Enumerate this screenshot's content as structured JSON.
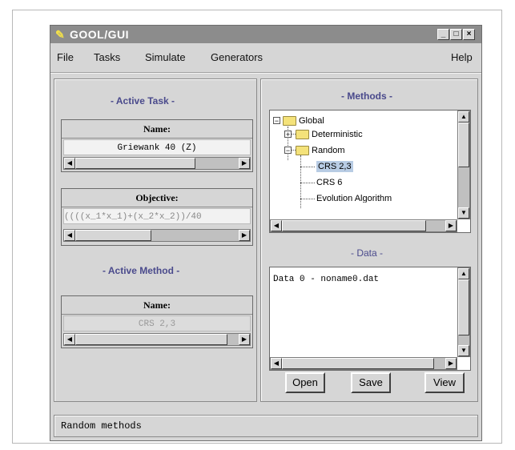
{
  "window": {
    "title": "GOOL/GUI"
  },
  "menu": {
    "file": "File",
    "tasks": "Tasks",
    "simulate": "Simulate",
    "generators": "Generators",
    "help": "Help"
  },
  "active_task": {
    "section_title": "- Active Task -",
    "name_header": "Name:",
    "name_value": "Griewank 40 (Z)",
    "objective_header": "Objective:",
    "objective_value": "((((x_1*x_1)+(x_2*x_2))/40"
  },
  "active_method": {
    "section_title": "- Active Method -",
    "name_header": "Name:",
    "name_value": "CRS 2,3"
  },
  "methods": {
    "section_title": "- Methods -",
    "tree": {
      "root": "Global",
      "deterministic": "Deterministic",
      "random": "Random",
      "items": [
        "CRS 2,3",
        "CRS 6",
        "Evolution Algorithm"
      ]
    },
    "selected": "CRS 2,3"
  },
  "data": {
    "section_title": "- Data -",
    "items": [
      "Data 0 - noname0.dat"
    ],
    "buttons": {
      "open": "Open",
      "save": "Save",
      "view": "View"
    }
  },
  "status": "Random methods"
}
